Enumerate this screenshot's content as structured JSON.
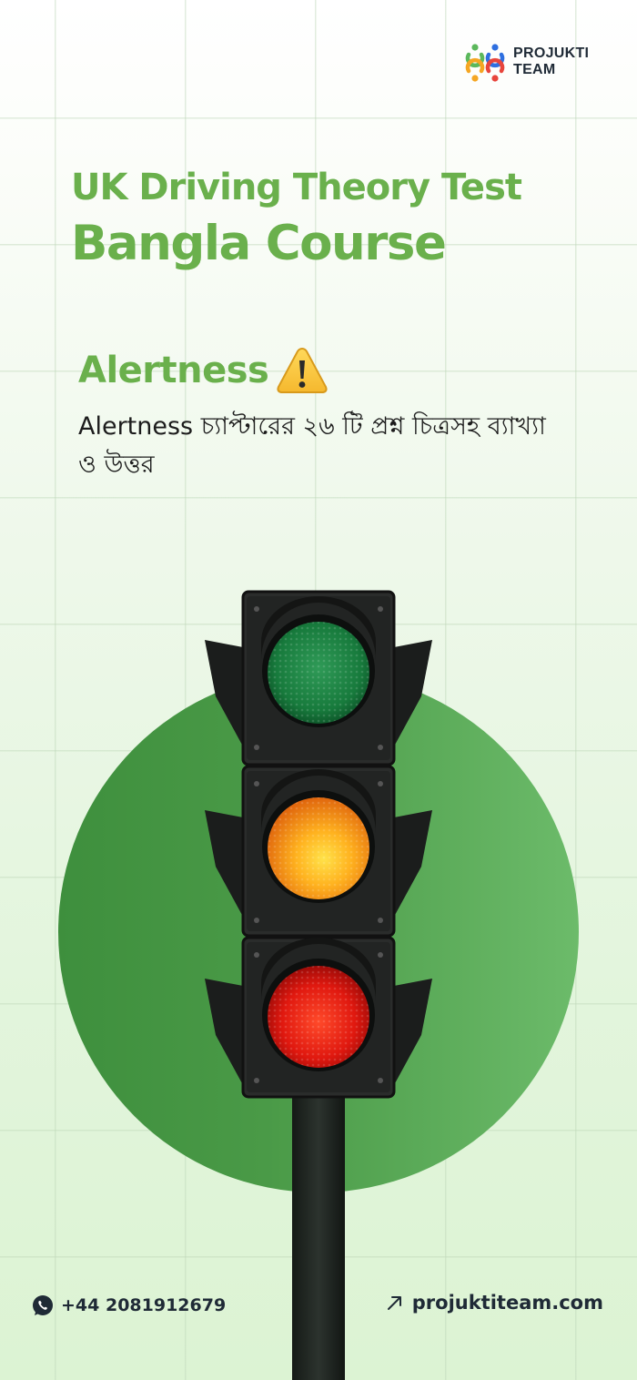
{
  "brand": {
    "name_line1": "PROJUKTI",
    "name_line2": "TEAM",
    "colors": {
      "blue": "#2f6fe0",
      "green": "#5cb85c",
      "orange": "#f5a623",
      "red": "#e8453c"
    }
  },
  "hero": {
    "title_line1": "UK Driving Theory Test",
    "title_line2": "Bangla Course",
    "accent_color": "#6ab04c"
  },
  "chapter": {
    "name": "Alertness",
    "icon": "warning-icon",
    "description": "Alertness চ্যাপ্টারের ২৬ টি প্রশ্ন চিত্রসহ ব্যাখ্যা ও উত্তর"
  },
  "illustration": {
    "subject": "traffic-light",
    "lights": [
      "green",
      "amber",
      "red"
    ],
    "backdrop_color": "#4a9a47"
  },
  "footer": {
    "phone_icon": "whatsapp-icon",
    "phone": "+44 2081912679",
    "link_icon": "arrow-up-right-icon",
    "website": "projuktiteam.com"
  }
}
